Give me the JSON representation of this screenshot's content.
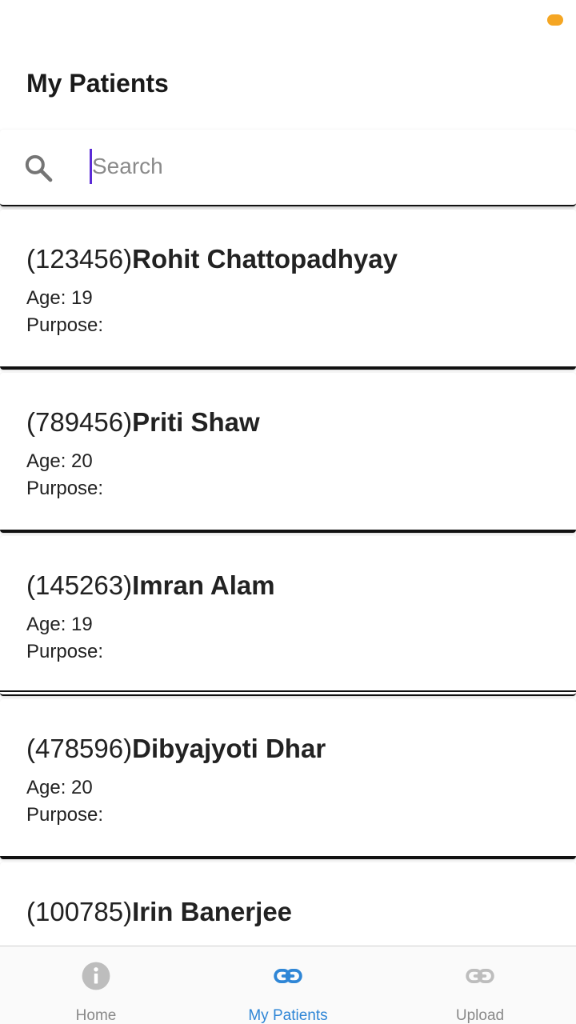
{
  "header": {
    "title": "My Patients"
  },
  "search": {
    "placeholder": "Search",
    "value": ""
  },
  "patients": [
    {
      "id": "(123456)",
      "name": "Rohit Chattopadhyay",
      "age": "Age: 19",
      "purpose": "Purpose:"
    },
    {
      "id": "(789456)",
      "name": "Priti Shaw",
      "age": "Age: 20",
      "purpose": "Purpose:"
    },
    {
      "id": "(145263)",
      "name": "Imran Alam",
      "age": "Age: 19",
      "purpose": "Purpose:"
    },
    {
      "id": "(478596)",
      "name": "Dibyajyoti Dhar",
      "age": "Age: 20",
      "purpose": "Purpose:"
    },
    {
      "id": "(100785)",
      "name": "Irin Banerjee",
      "age": "",
      "purpose": ""
    }
  ],
  "bottom_nav": {
    "home": {
      "label": "Home",
      "icon": "info-icon"
    },
    "my_patients": {
      "label": "My Patients",
      "icon": "link-icon"
    },
    "upload": {
      "label": "Upload",
      "icon": "link-icon"
    }
  },
  "colors": {
    "accent": "#2f86d6",
    "inactive": "#bdbdbd",
    "cursor": "#5b2bd6",
    "status_dot": "#f5a623"
  }
}
